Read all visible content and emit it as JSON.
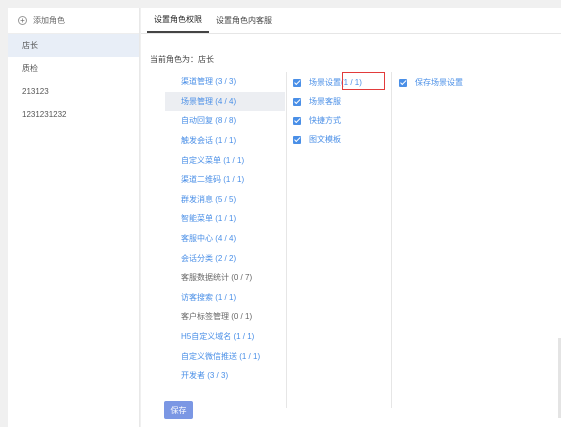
{
  "sidebar": {
    "add_role_label": "添加角色",
    "roles": [
      "店长",
      "质检",
      "213123",
      "1231231232"
    ]
  },
  "tabs": [
    "设置角色权限",
    "设置角色内客服"
  ],
  "current_role_label": "当前角色为：店长",
  "modules": [
    {
      "label": "渠道管理 (3 / 3)",
      "state": "full"
    },
    {
      "label": "场景管理 (4 / 4)",
      "state": "full"
    },
    {
      "label": "自动回复 (8 / 8)",
      "state": "full"
    },
    {
      "label": "触发会话 (1 / 1)",
      "state": "full"
    },
    {
      "label": "自定义菜单 (1 / 1)",
      "state": "full"
    },
    {
      "label": "渠道二维码 (1 / 1)",
      "state": "full"
    },
    {
      "label": "群发消息 (5 / 5)",
      "state": "full"
    },
    {
      "label": "智能菜单 (1 / 1)",
      "state": "full"
    },
    {
      "label": "客服中心 (4 / 4)",
      "state": "full"
    },
    {
      "label": "会话分类 (2 / 2)",
      "state": "full"
    },
    {
      "label": "客服数据统计 (0 / 7)",
      "state": "empty"
    },
    {
      "label": "访客搜索 (1 / 1)",
      "state": "full"
    },
    {
      "label": "客户标签管理 (0 / 1)",
      "state": "empty"
    },
    {
      "label": "H5自定义域名 (1 / 1)",
      "state": "full"
    },
    {
      "label": "自定义微信推送 (1 / 1)",
      "state": "full"
    },
    {
      "label": "开发者 (3 / 3)",
      "state": "full"
    }
  ],
  "submodules": [
    {
      "label": "场景设置(1 / 1)"
    },
    {
      "label": "场景客服"
    },
    {
      "label": "快捷方式"
    },
    {
      "label": "图文模板"
    }
  ],
  "permissions": [
    {
      "label": "保存场景设置"
    }
  ],
  "save_button_label": "保存",
  "colors": {
    "accent": "#4a8fe7",
    "highlight_box": "#e23b3b",
    "button": "#7b97e4",
    "selected_bg": "#eceef2"
  }
}
